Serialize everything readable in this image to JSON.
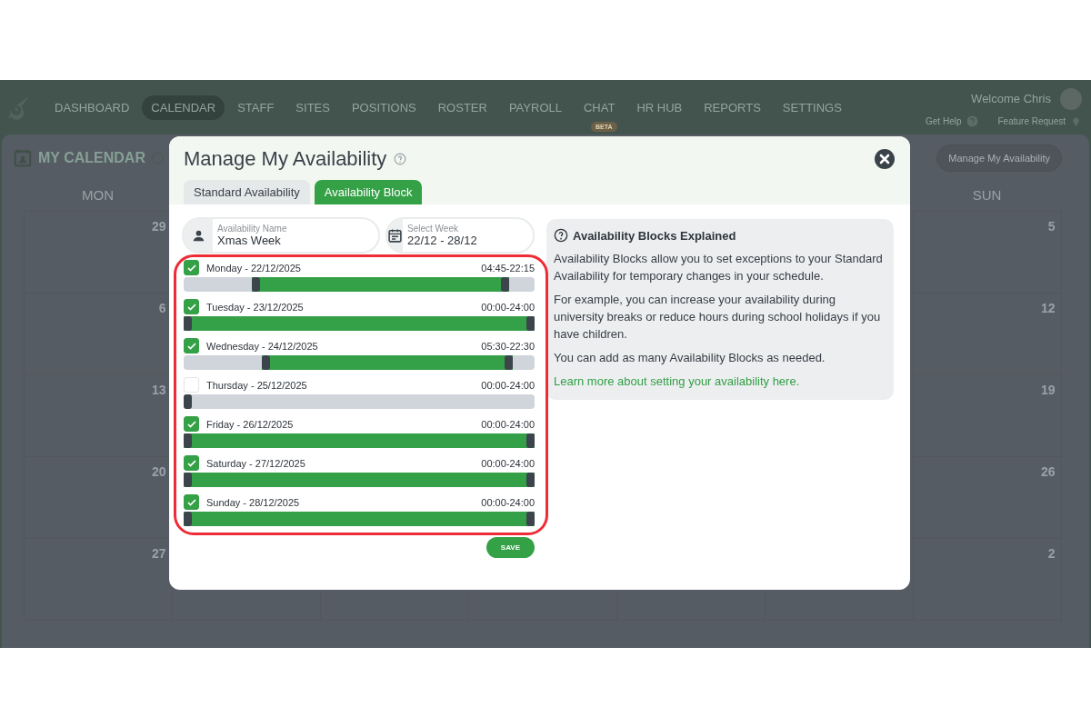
{
  "nav": {
    "items": [
      {
        "label": "DASHBOARD",
        "selected": false
      },
      {
        "label": "CALENDAR",
        "selected": true
      },
      {
        "label": "STAFF",
        "selected": false
      },
      {
        "label": "SITES",
        "selected": false
      },
      {
        "label": "POSITIONS",
        "selected": false
      },
      {
        "label": "ROSTER",
        "selected": false
      },
      {
        "label": "PAYROLL",
        "selected": false
      },
      {
        "label": "CHAT",
        "selected": false,
        "badge": "BETA"
      },
      {
        "label": "HR HUB",
        "selected": false
      },
      {
        "label": "REPORTS",
        "selected": false
      },
      {
        "label": "SETTINGS",
        "selected": false
      }
    ],
    "welcome": "Welcome Chris",
    "help": "Get Help",
    "feature": "Feature Request"
  },
  "page": {
    "title": "MY CALENDAR",
    "button": "Manage My Availability"
  },
  "calendar": {
    "first_column": {
      "day": "MON",
      "dates": [
        "29",
        "6",
        "13",
        "20",
        "27"
      ]
    },
    "last_column": {
      "day": "SUN",
      "dates": [
        "5",
        "12",
        "19",
        "26",
        "2"
      ]
    }
  },
  "modal": {
    "title": "Manage My Availability",
    "tabs": [
      {
        "label": "Standard Availability",
        "selected": false
      },
      {
        "label": "Availability Block",
        "selected": true
      }
    ],
    "fields": [
      {
        "kind": "person",
        "label": "Availability Name",
        "value": "Xmas Week"
      },
      {
        "kind": "calendar",
        "label": "Select Week",
        "value": "22/12 - 28/12"
      }
    ],
    "days": [
      {
        "label": "Monday - 22/12/2025",
        "checked": true,
        "time": "04:45-22:15",
        "thumbs": [
          {
            "level": 0.198
          },
          {
            "level": 0.927
          }
        ]
      },
      {
        "label": "Tuesday - 23/12/2025",
        "checked": true,
        "time": "00:00-24:00",
        "thumbs": [
          {
            "level": 0
          },
          {
            "level": 1
          }
        ]
      },
      {
        "label": "Wednesday - 24/12/2025",
        "checked": true,
        "time": "05:30-22:30",
        "thumbs": [
          {
            "level": 0.229
          },
          {
            "level": 0.9375
          }
        ]
      },
      {
        "label": "Thursday - 25/12/2025",
        "checked": false,
        "time": "00:00-24:00",
        "thumbs": [
          {
            "level": 0
          }
        ]
      },
      {
        "label": "Friday - 26/12/2025",
        "checked": true,
        "time": "00:00-24:00",
        "thumbs": [
          {
            "level": 0
          },
          {
            "level": 1
          }
        ]
      },
      {
        "label": "Saturday - 27/12/2025",
        "checked": true,
        "time": "00:00-24:00",
        "thumbs": [
          {
            "level": 0
          },
          {
            "level": 1
          }
        ]
      },
      {
        "label": "Sunday - 28/12/2025",
        "checked": true,
        "time": "00:00-24:00",
        "thumbs": [
          {
            "level": 0
          },
          {
            "level": 1
          }
        ]
      }
    ],
    "save": "SAVE",
    "info": {
      "title": "Availability Blocks Explained",
      "paragraphs": [
        "Availability Blocks allow you to set exceptions to your Standard Availability for temporary changes in your schedule.",
        "For example, you can increase your availability during university breaks or reduce hours during school holidays if you have children.",
        "You can add as many Availability Blocks as needed."
      ],
      "link": "Learn more about setting your availability here."
    }
  }
}
